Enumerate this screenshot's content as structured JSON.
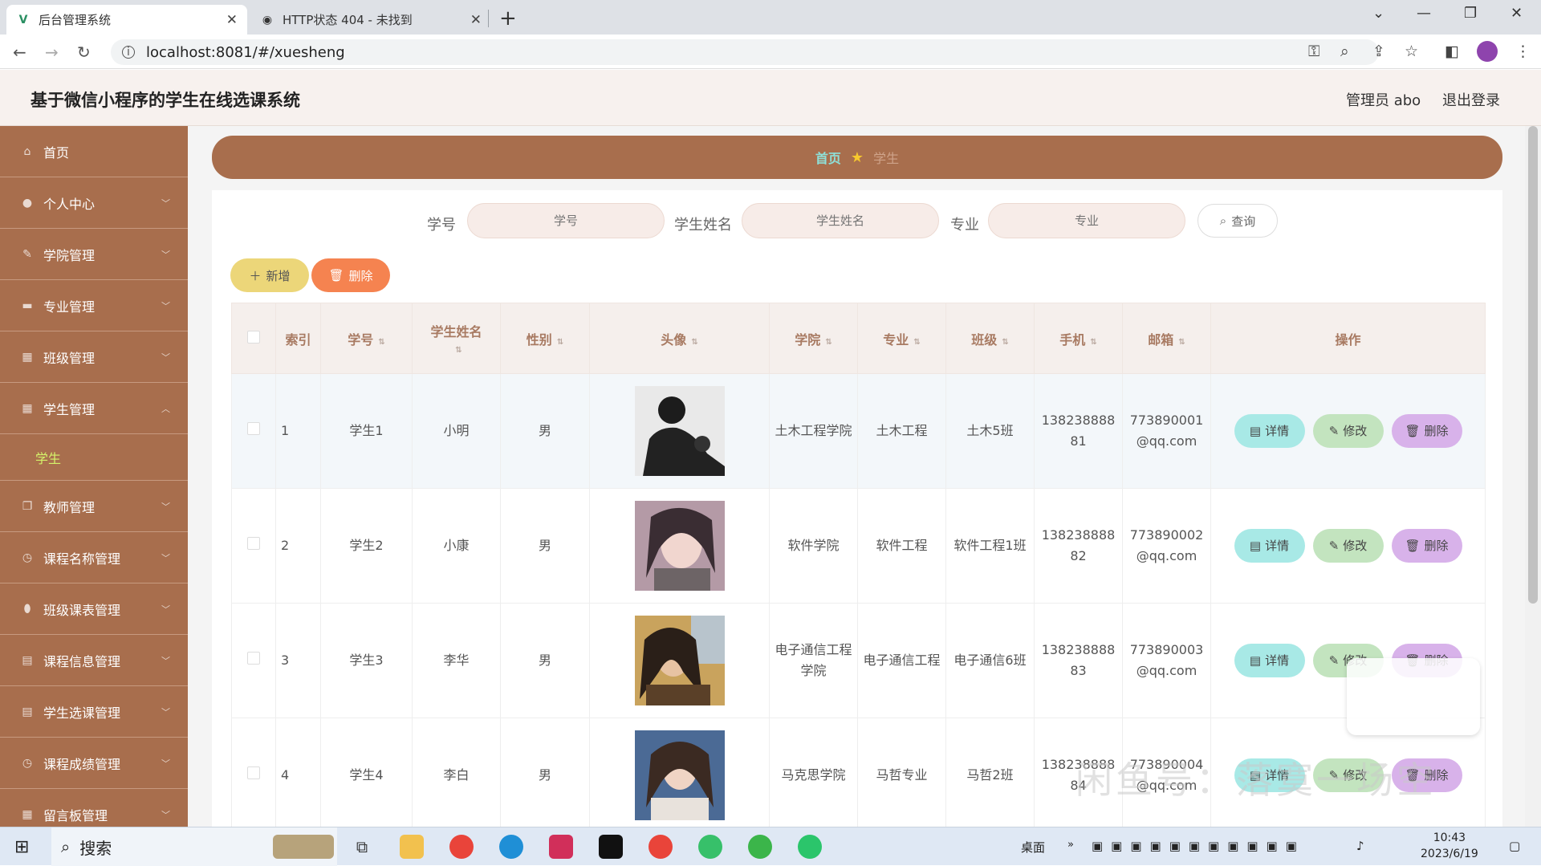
{
  "browser": {
    "tabs": [
      {
        "title": "后台管理系统",
        "active": true
      },
      {
        "title": "HTTP状态 404 - 未找到",
        "active": false
      }
    ],
    "url": "localhost:8081/#/xuesheng"
  },
  "app": {
    "title": "基于微信小程序的学生在线选课系统",
    "user_label": "管理员 abo",
    "logout_label": "退出登录"
  },
  "sidebar": {
    "items": [
      {
        "label": "首页",
        "icon": "home-icon"
      },
      {
        "label": "个人中心",
        "icon": "user-icon"
      },
      {
        "label": "学院管理",
        "icon": "pen-icon"
      },
      {
        "label": "专业管理",
        "icon": "monitor-icon"
      },
      {
        "label": "班级管理",
        "icon": "chart-icon"
      },
      {
        "label": "学生管理",
        "icon": "grid-icon",
        "expanded": true
      },
      {
        "label": "学生",
        "sub": true
      },
      {
        "label": "教师管理",
        "icon": "copy-icon"
      },
      {
        "label": "课程名称管理",
        "icon": "clock-icon"
      },
      {
        "label": "班级课表管理",
        "icon": "pin-icon"
      },
      {
        "label": "课程信息管理",
        "icon": "doc-icon"
      },
      {
        "label": "学生选课管理",
        "icon": "doc-icon"
      },
      {
        "label": "课程成绩管理",
        "icon": "clock-icon"
      },
      {
        "label": "留言板管理",
        "icon": "grid-icon"
      }
    ]
  },
  "breadcrumb": {
    "home": "首页",
    "current": "学生"
  },
  "search": {
    "fields": [
      {
        "label": "学号",
        "placeholder": "学号"
      },
      {
        "label": "学生姓名",
        "placeholder": "学生姓名"
      },
      {
        "label": "专业",
        "placeholder": "专业"
      }
    ],
    "query_label": "查询"
  },
  "actions": {
    "add_label": "新增",
    "delete_label": "删除"
  },
  "table": {
    "headers": [
      "索引",
      "学号",
      "学生姓名",
      "性别",
      "头像",
      "学院",
      "专业",
      "班级",
      "手机",
      "邮箱",
      "操作"
    ],
    "rows": [
      {
        "index": "1",
        "xuehao": "学生1",
        "name": "小明",
        "gender": "男",
        "college": "土木工程学院",
        "major": "土木工程",
        "class": "土木5班",
        "phone": "13823888881",
        "email": "773890001@qq.com"
      },
      {
        "index": "2",
        "xuehao": "学生2",
        "name": "小康",
        "gender": "男",
        "college": "软件学院",
        "major": "软件工程",
        "class": "软件工程1班",
        "phone": "13823888882",
        "email": "773890002@qq.com"
      },
      {
        "index": "3",
        "xuehao": "学生3",
        "name": "李华",
        "gender": "男",
        "college": "电子通信工程学院",
        "major": "电子通信工程",
        "class": "电子通信6班",
        "phone": "13823888883",
        "email": "773890003@qq.com"
      },
      {
        "index": "4",
        "xuehao": "学生4",
        "name": "李白",
        "gender": "男",
        "college": "马克思学院",
        "major": "马哲专业",
        "class": "马哲2班",
        "phone": "13823888884",
        "email": "773890004@qq.com"
      }
    ],
    "op_labels": {
      "detail": "详情",
      "edit": "修改",
      "remove": "删除"
    }
  },
  "watermark": {
    "text": "闲鱼号：落寞一场空"
  },
  "taskbar": {
    "search_label": "搜索",
    "desktop_label": "桌面",
    "time": "10:43",
    "date": "2023/6/19"
  },
  "colors": {
    "accent": "#a86e4d",
    "detail_btn": "#a8e9e6",
    "edit_btn": "#c3e4bf",
    "remove_btn": "#d8b2ea",
    "add_btn": "#ecd679",
    "delete_btn": "#f58350"
  }
}
